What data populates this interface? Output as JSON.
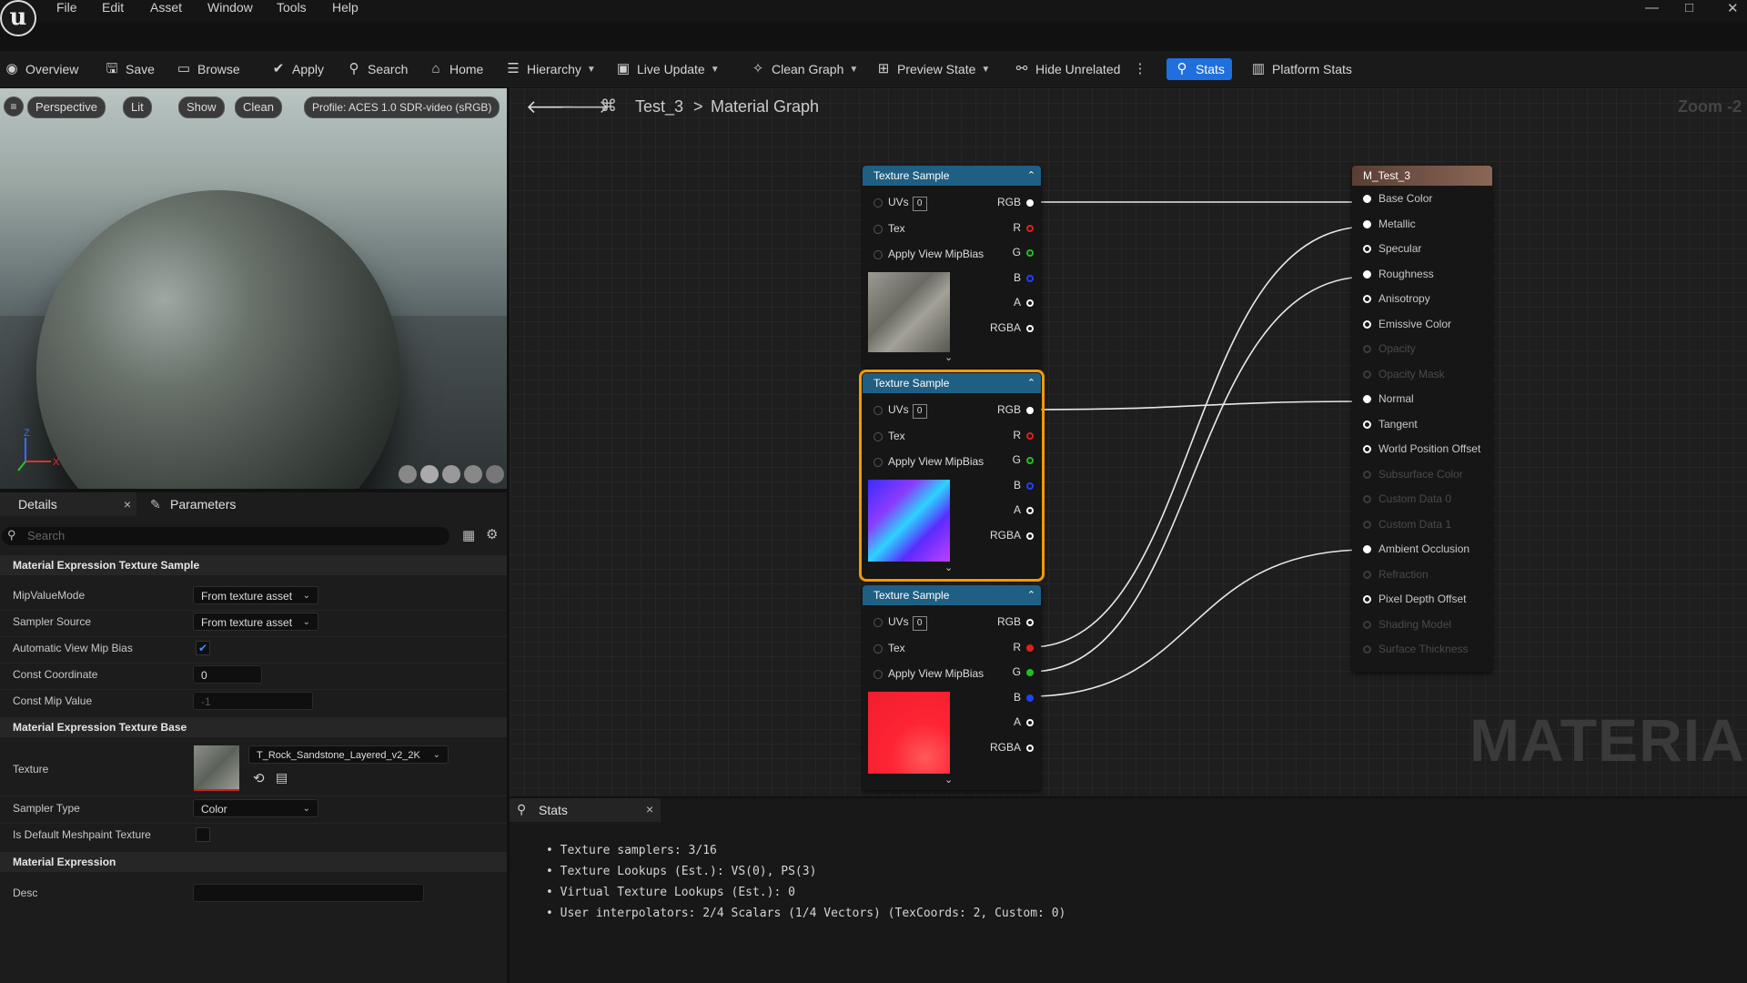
{
  "menu": {
    "items": [
      "File",
      "Edit",
      "Asset",
      "Window",
      "Tools",
      "Help"
    ],
    "logo": "u"
  },
  "window_controls": {
    "minimize": "—",
    "maximize": "□",
    "close": "✕"
  },
  "toolbar": {
    "overview": "Overview",
    "save": "Save",
    "browse": "Browse",
    "apply": "Apply",
    "search": "Search",
    "home": "Home",
    "hierarchy": "Hierarchy",
    "live_update": "Live Update",
    "clean_graph": "Clean Graph",
    "preview_state": "Preview State",
    "hide_unrelated": "Hide Unrelated",
    "stats": "Stats",
    "platform_stats": "Platform Stats"
  },
  "viewport": {
    "perspective": "Perspective",
    "lit": "Lit",
    "show": "Show",
    "clean": "Clean",
    "profile": "Profile: ACES 1.0 SDR-video (sRGB)",
    "axis_z": "Z",
    "axis_x": "X"
  },
  "details": {
    "tab_details": "Details",
    "tab_parameters": "Parameters",
    "search_placeholder": "Search",
    "section1": "Material Expression Texture Sample",
    "mip_value_mode_label": "MipValueMode",
    "mip_value_mode": "From texture asset",
    "sampler_source_label": "Sampler Source",
    "sampler_source": "From texture asset",
    "auto_view_mip_bias_label": "Automatic View Mip Bias",
    "auto_view_mip_bias": true,
    "const_coordinate_label": "Const Coordinate",
    "const_coordinate": "0",
    "const_mip_value_label": "Const Mip Value",
    "const_mip_value": "-1",
    "section2": "Material Expression Texture Base",
    "texture_label": "Texture",
    "texture": "T_Rock_Sandstone_Layered_v2_2K",
    "sampler_type_label": "Sampler Type",
    "sampler_type": "Color",
    "default_meshpaint_label": "Is Default Meshpaint Texture",
    "default_meshpaint": false,
    "section3": "Material Expression",
    "desc_label": "Desc",
    "desc": ""
  },
  "graph": {
    "breadcrumb_asset": "Test_3",
    "breadcrumb_sep": ">",
    "breadcrumb_graph": "Material Graph",
    "zoom": "Zoom -2",
    "watermark": "MATERIAL",
    "texture_nodes": [
      {
        "title": "Texture Sample",
        "uv_index": "0",
        "inputs": [
          "UVs",
          "Tex",
          "Apply View MipBias"
        ],
        "outputs": [
          "RGB",
          "R",
          "G",
          "B",
          "A",
          "RGBA"
        ],
        "preview": "rock-texture"
      },
      {
        "title": "Texture Sample",
        "uv_index": "0",
        "inputs": [
          "UVs",
          "Tex",
          "Apply View MipBias"
        ],
        "outputs": [
          "RGB",
          "R",
          "G",
          "B",
          "A",
          "RGBA"
        ],
        "preview": "normal-map"
      },
      {
        "title": "Texture Sample",
        "uv_index": "0",
        "inputs": [
          "UVs",
          "Tex",
          "Apply View MipBias"
        ],
        "outputs": [
          "RGB",
          "R",
          "G",
          "B",
          "A",
          "RGBA"
        ],
        "preview": "packed-mask"
      }
    ],
    "material_node": {
      "title": "M_Test_3",
      "pins": [
        {
          "label": "Base Color",
          "enabled": true,
          "connected": true
        },
        {
          "label": "Metallic",
          "enabled": true,
          "connected": true
        },
        {
          "label": "Specular",
          "enabled": true,
          "connected": false
        },
        {
          "label": "Roughness",
          "enabled": true,
          "connected": true
        },
        {
          "label": "Anisotropy",
          "enabled": true,
          "connected": false
        },
        {
          "label": "Emissive Color",
          "enabled": true,
          "connected": false
        },
        {
          "label": "Opacity",
          "enabled": false,
          "connected": false
        },
        {
          "label": "Opacity Mask",
          "enabled": false,
          "connected": false
        },
        {
          "label": "Normal",
          "enabled": true,
          "connected": true
        },
        {
          "label": "Tangent",
          "enabled": true,
          "connected": false
        },
        {
          "label": "World Position Offset",
          "enabled": true,
          "connected": false
        },
        {
          "label": "Subsurface Color",
          "enabled": false,
          "connected": false
        },
        {
          "label": "Custom Data 0",
          "enabled": false,
          "connected": false
        },
        {
          "label": "Custom Data 1",
          "enabled": false,
          "connected": false
        },
        {
          "label": "Ambient Occlusion",
          "enabled": true,
          "connected": true
        },
        {
          "label": "Refraction",
          "enabled": false,
          "connected": false
        },
        {
          "label": "Pixel Depth Offset",
          "enabled": true,
          "connected": false
        },
        {
          "label": "Shading Model",
          "enabled": false,
          "connected": false
        },
        {
          "label": "Surface Thickness",
          "enabled": false,
          "connected": false
        }
      ]
    }
  },
  "stats": {
    "tab": "Stats",
    "lines": [
      "Texture samplers: 3/16",
      "Texture Lookups (Est.): VS(0), PS(3)",
      "Virtual Texture Lookups (Est.): 0",
      "User interpolators: 2/4 Scalars (1/4 Vectors) (TexCoords: 2, Custom: 0)"
    ]
  },
  "colors": {
    "accent": "#1f6fde",
    "node_header": "#1f5f83",
    "material_header": "#7a5a4a",
    "selection": "#f29a00",
    "pin_r": "#e02020",
    "pin_g": "#20c020",
    "pin_b": "#2040ff"
  }
}
